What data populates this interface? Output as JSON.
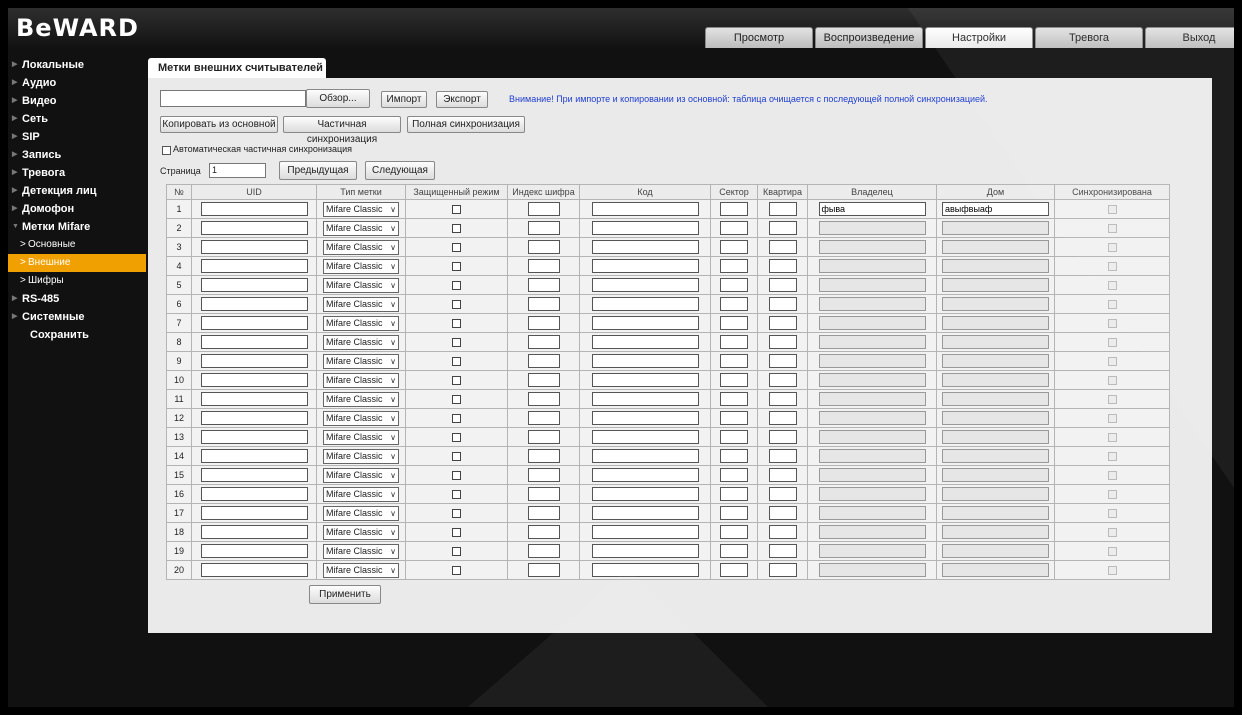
{
  "brand": {
    "logo": "BeWARD"
  },
  "top_tabs": [
    {
      "label": "Просмотр",
      "active": false
    },
    {
      "label": "Воспроизведение",
      "active": false
    },
    {
      "label": "Настройки",
      "active": true
    },
    {
      "label": "Тревога",
      "active": false
    },
    {
      "label": "Выход",
      "active": false
    }
  ],
  "sidebar": {
    "items": [
      {
        "label": "Локальные",
        "type": "main"
      },
      {
        "label": "Аудио",
        "type": "main"
      },
      {
        "label": "Видео",
        "type": "main"
      },
      {
        "label": "Сеть",
        "type": "main"
      },
      {
        "label": "SIP",
        "type": "main"
      },
      {
        "label": "Запись",
        "type": "main"
      },
      {
        "label": "Тревога",
        "type": "main"
      },
      {
        "label": "Детекция лиц",
        "type": "main"
      },
      {
        "label": "Домофон",
        "type": "main"
      },
      {
        "label": "Метки Mifare",
        "type": "expanded"
      },
      {
        "label": "Основные",
        "type": "sub"
      },
      {
        "label": "Внешние",
        "type": "sub",
        "active": true
      },
      {
        "label": "Шифры",
        "type": "sub"
      },
      {
        "label": "RS-485",
        "type": "main"
      },
      {
        "label": "Системные",
        "type": "main"
      },
      {
        "label": "Сохранить",
        "type": "save"
      }
    ]
  },
  "page_title": "Метки внешних считывателей",
  "file": {
    "browse_label": "Обзор...",
    "value": ""
  },
  "buttons": {
    "import": "Импорт",
    "export": "Экспорт",
    "copy_from_main": "Копировать из основной",
    "partial_sync": "Частичная синхронизация",
    "full_sync": "Полная синхронизация",
    "prev": "Предыдущая",
    "next": "Следующая",
    "apply": "Применить"
  },
  "warning": "Внимание! При импорте и копировании из основной: таблица очищается с последующей полной синхронизацией.",
  "auto_sync_label": "Автоматическая частичная синхронизация",
  "page": {
    "label": "Страница",
    "value": "1"
  },
  "table": {
    "headers": [
      "№",
      "UID",
      "Тип метки",
      "Защищенный режим",
      "Индекс шифра",
      "Код",
      "Сектор",
      "Квартира",
      "Владелец",
      "Дом",
      "Синхронизирована"
    ],
    "tag_type": "Mifare Classic",
    "rows": [
      {
        "n": "1",
        "owner": "фыва",
        "house": "авыфвыаф"
      },
      {
        "n": "2",
        "owner": "",
        "house": ""
      },
      {
        "n": "3",
        "owner": "",
        "house": ""
      },
      {
        "n": "4",
        "owner": "",
        "house": ""
      },
      {
        "n": "5",
        "owner": "",
        "house": ""
      },
      {
        "n": "6",
        "owner": "",
        "house": ""
      },
      {
        "n": "7",
        "owner": "",
        "house": ""
      },
      {
        "n": "8",
        "owner": "",
        "house": ""
      },
      {
        "n": "9",
        "owner": "",
        "house": ""
      },
      {
        "n": "10",
        "owner": "",
        "house": ""
      },
      {
        "n": "11",
        "owner": "",
        "house": ""
      },
      {
        "n": "12",
        "owner": "",
        "house": ""
      },
      {
        "n": "13",
        "owner": "",
        "house": ""
      },
      {
        "n": "14",
        "owner": "",
        "house": ""
      },
      {
        "n": "15",
        "owner": "",
        "house": ""
      },
      {
        "n": "16",
        "owner": "",
        "house": ""
      },
      {
        "n": "17",
        "owner": "",
        "house": ""
      },
      {
        "n": "18",
        "owner": "",
        "house": ""
      },
      {
        "n": "19",
        "owner": "",
        "house": ""
      },
      {
        "n": "20",
        "owner": "",
        "house": ""
      }
    ]
  },
  "colors": {
    "accent": "#f0a000",
    "warning_text": "#1f3fcf",
    "panel": "#eaeaea"
  }
}
